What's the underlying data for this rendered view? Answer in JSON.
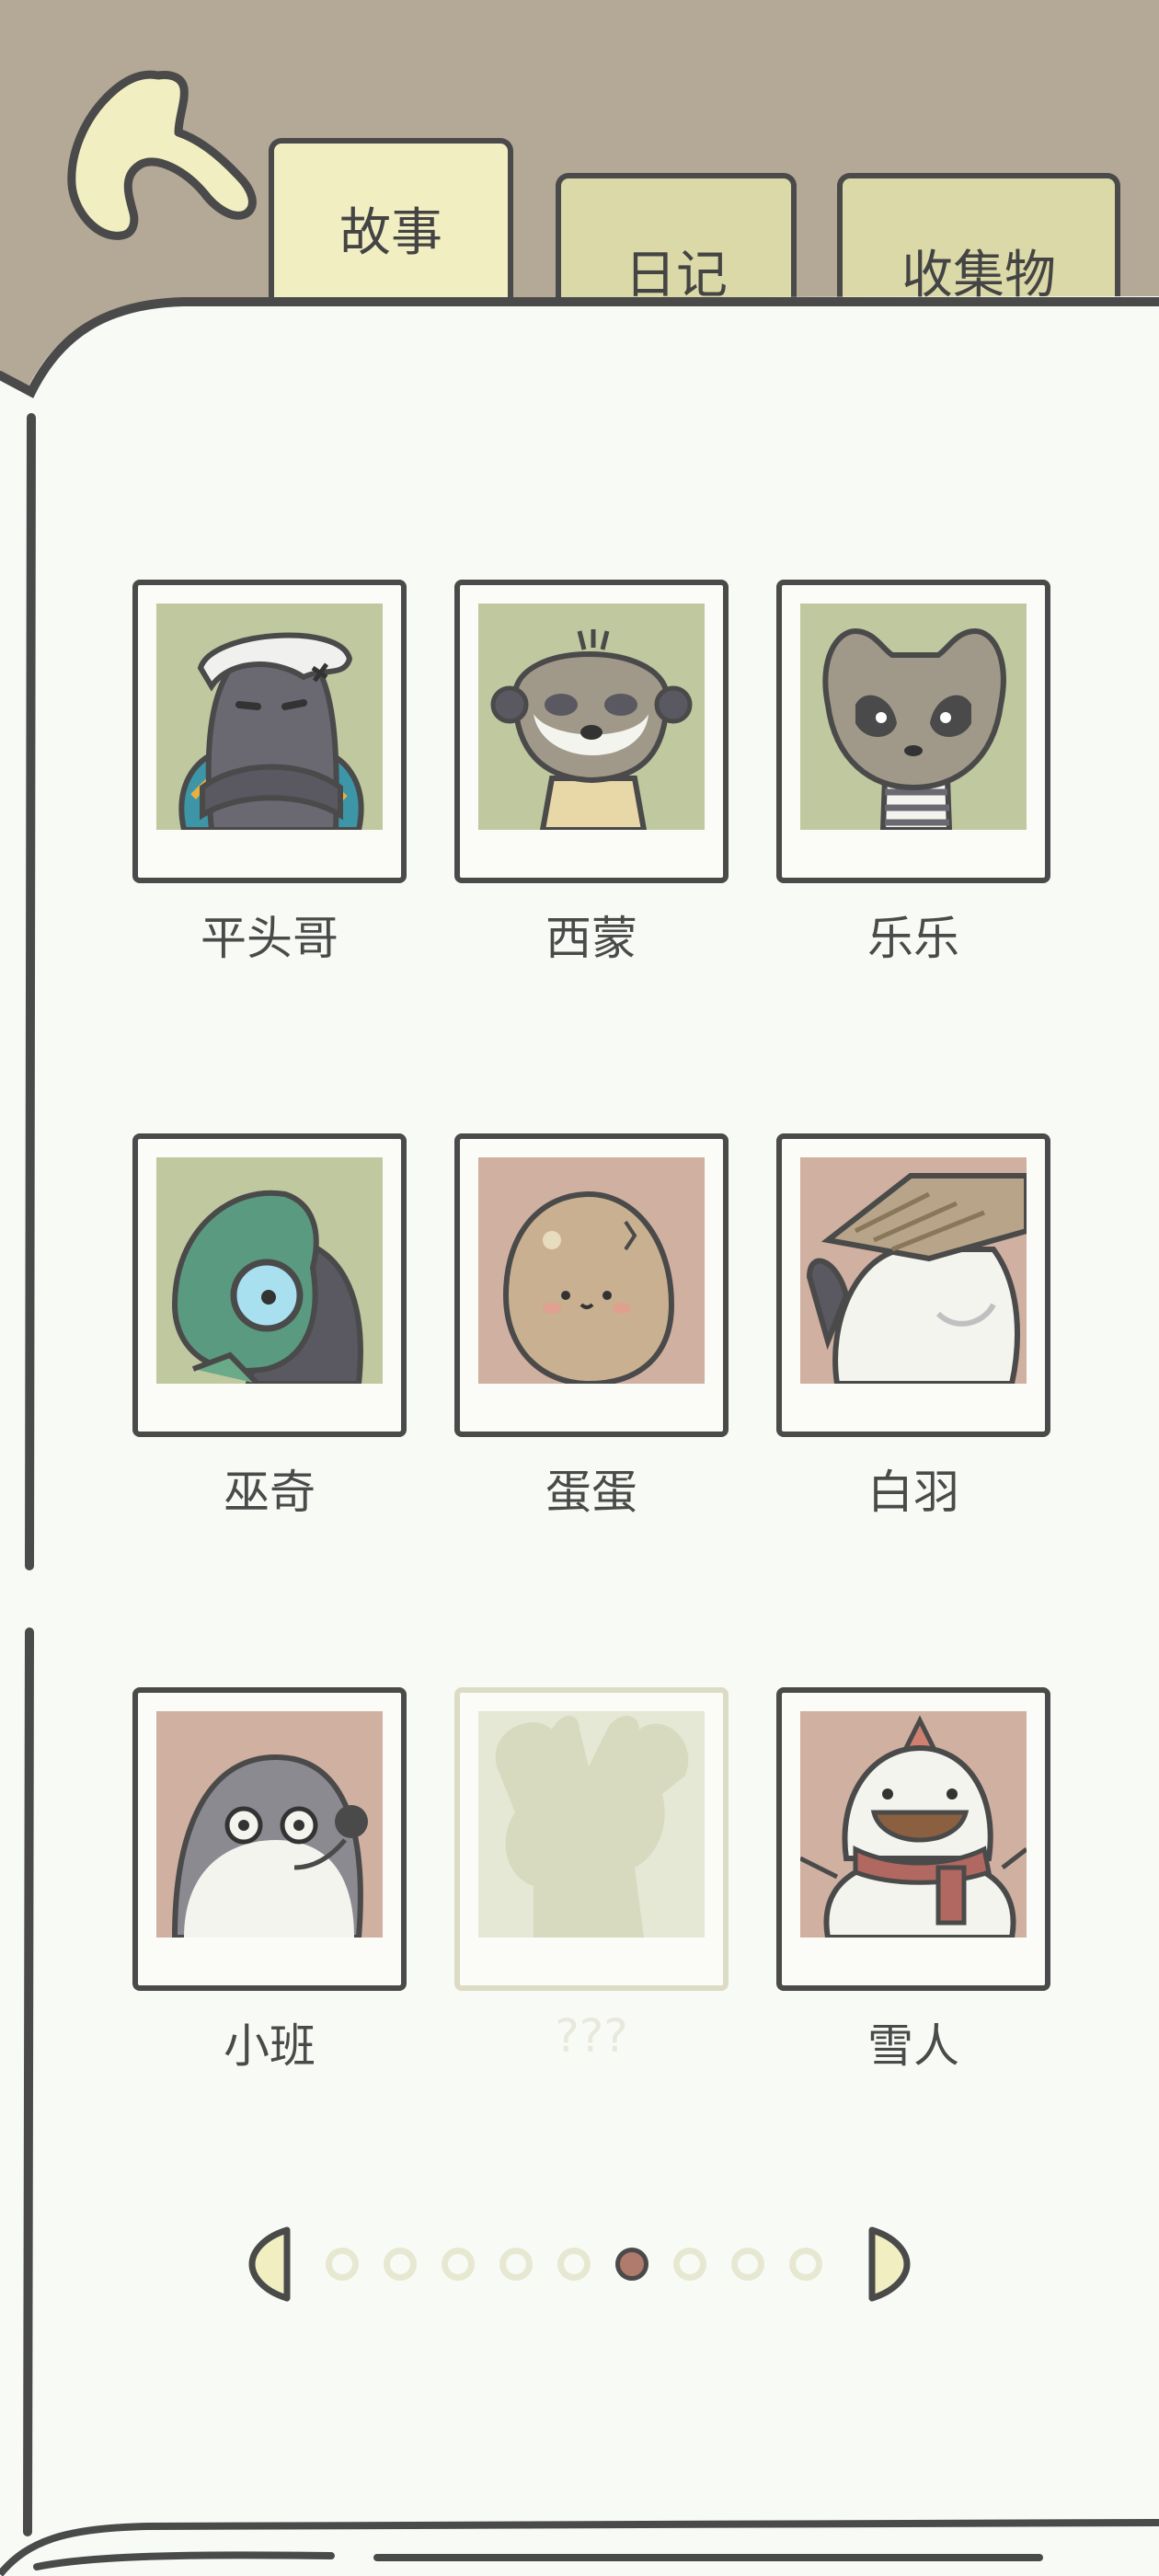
{
  "tabs": {
    "story": "故事",
    "diary": "日记",
    "collection": "收集物"
  },
  "characters": [
    {
      "name": "平头哥",
      "bg": "#c0c8a0",
      "icon": "honey-badger-portrait-icon",
      "locked": false
    },
    {
      "name": "西蒙",
      "bg": "#c0c8a0",
      "icon": "meerkat-portrait-icon",
      "locked": false
    },
    {
      "name": "乐乐",
      "bg": "#c0c8a0",
      "icon": "raccoon-portrait-icon",
      "locked": false
    },
    {
      "name": "巫奇",
      "bg": "#c0c8a0",
      "icon": "chameleon-portrait-icon",
      "locked": false
    },
    {
      "name": "蛋蛋",
      "bg": "#d0b0a0",
      "icon": "potato-egg-portrait-icon",
      "locked": false
    },
    {
      "name": "白羽",
      "bg": "#d0b0a0",
      "icon": "white-bird-portrait-icon",
      "locked": false
    },
    {
      "name": "小班",
      "bg": "#d0b0a0",
      "icon": "seal-portrait-icon",
      "locked": false
    },
    {
      "name": "???",
      "bg": "#e4e8d4",
      "icon": "moose-silhouette-icon",
      "locked": true
    },
    {
      "name": "雪人",
      "bg": "#d0b0a0",
      "icon": "snowman-portrait-icon",
      "locked": false
    }
  ],
  "pagination": {
    "total_pages": 9,
    "current_page": 6
  },
  "colors": {
    "background": "#b4a897",
    "paper": "#f8fbf5",
    "active_tab": "#f1efc2",
    "inactive_tab": "#dbd9a8",
    "active_dot": "#b07a6c",
    "outline": "#4a4a4a"
  }
}
